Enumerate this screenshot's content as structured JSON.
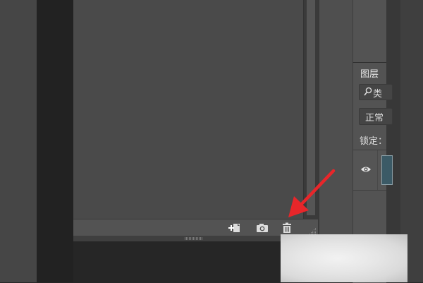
{
  "history_panel": {
    "buttons": {
      "new_document_label": "new-document-from-state",
      "snapshot_label": "create-new-snapshot",
      "delete_label": "delete-current-state"
    }
  },
  "layers_panel": {
    "tab_label": "图层",
    "filter_text": "类",
    "blend_mode": "正常",
    "lock_label": "锁定："
  },
  "colors": {
    "panel_bg": "#4a4a4a",
    "footer_bg": "#535353",
    "annotation_arrow": "#e8262a"
  }
}
